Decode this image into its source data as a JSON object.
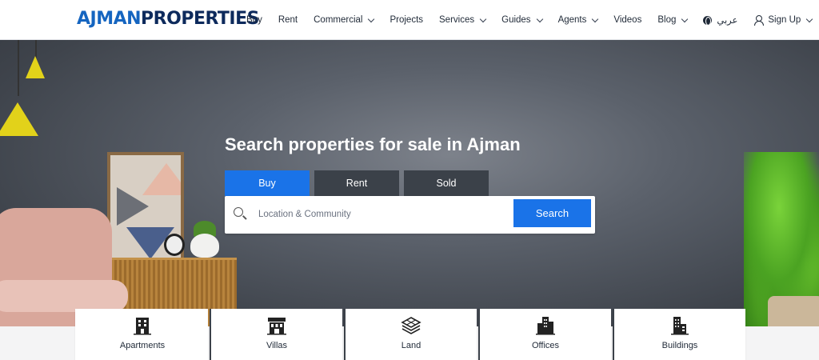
{
  "logo": {
    "part1": "AJMAN",
    "part2": "PROPERTIES"
  },
  "nav": {
    "buy": "Buy",
    "rent": "Rent",
    "commercial": "Commercial",
    "projects": "Projects",
    "services": "Services",
    "guides": "Guides",
    "agents": "Agents",
    "videos": "Videos",
    "blog": "Blog",
    "language": "عربي",
    "signup": "Sign Up"
  },
  "hero": {
    "title": "Search properties for sale in Ajman",
    "tabs": [
      {
        "label": "Buy",
        "active": true
      },
      {
        "label": "Rent",
        "active": false
      },
      {
        "label": "Sold",
        "active": false
      }
    ],
    "search": {
      "placeholder": "Location & Community",
      "value": "",
      "button": "Search"
    }
  },
  "categories": [
    {
      "label": "Apartments",
      "icon": "apartment-building-icon"
    },
    {
      "label": "Villas",
      "icon": "villa-icon"
    },
    {
      "label": "Land",
      "icon": "land-layers-icon"
    },
    {
      "label": "Offices",
      "icon": "office-tower-icon"
    },
    {
      "label": "Buildings",
      "icon": "buildings-icon"
    }
  ],
  "colors": {
    "accent": "#1a73e8",
    "logo_primary": "#1565c0",
    "logo_dark": "#0d2a5c",
    "tab_inactive": "#3b4149"
  }
}
